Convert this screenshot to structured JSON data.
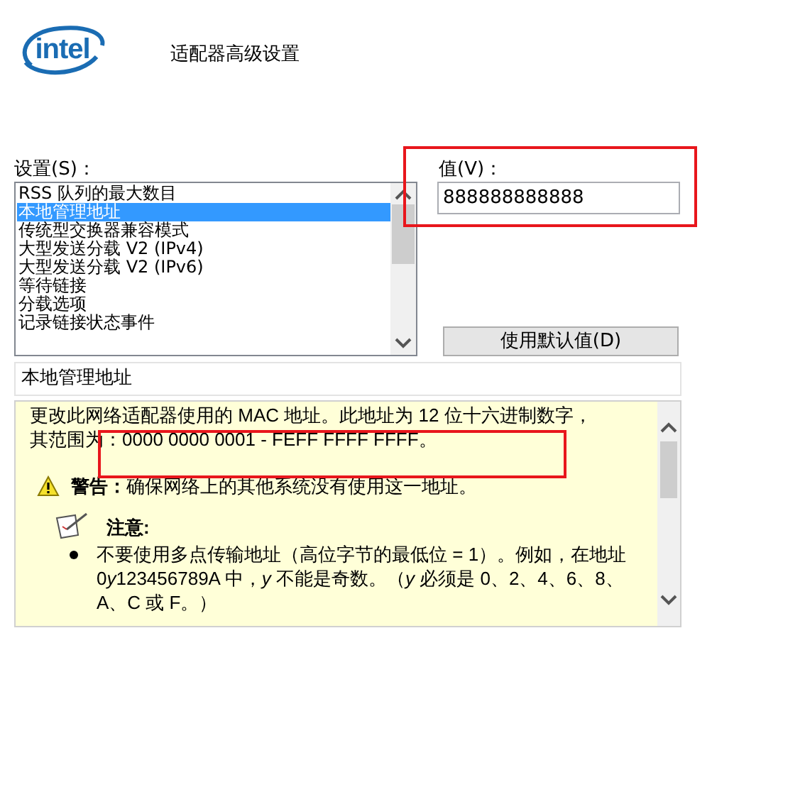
{
  "logo": {
    "text": "intel"
  },
  "title": "适配器高级设置",
  "settings": {
    "label": "设置(S)：",
    "items": [
      {
        "label": "RSS 队列的最大数目",
        "selected": false
      },
      {
        "label": "本地管理地址",
        "selected": true
      },
      {
        "label": "传统型交换器兼容模式",
        "selected": false
      },
      {
        "label": "大型发送分载 V2 (IPv4)",
        "selected": false
      },
      {
        "label": "大型发送分载 V2 (IPv6)",
        "selected": false
      },
      {
        "label": "等待链接",
        "selected": false
      },
      {
        "label": "分载选项",
        "selected": false
      },
      {
        "label": "记录链接状态事件",
        "selected": false
      }
    ]
  },
  "value": {
    "label": "值(V)：",
    "value": "888888888888"
  },
  "default_button": "使用默认值(D)",
  "description": "本地管理地址",
  "help": {
    "paragraph": "更改此网络适配器使用的 MAC 地址。此地址为 12 位十六进制数字，其范围为：0000 0000 0001 - FEFF FFFF FFFF。",
    "warning": "**警告：**确保网络上的其他系统没有使用这一地址。",
    "note_title": "注意:",
    "bullets": [
      [
        {
          "text": "不要使用多点传输地址（高位字节的最低位 = 1）。例如，在地址 0",
          "italic": false
        },
        {
          "text": "y",
          "italic": true
        },
        {
          "text": "123456789A 中，",
          "italic": false
        },
        {
          "text": "y",
          "italic": true
        },
        {
          "text": " 不能是奇数。（",
          "italic": false
        },
        {
          "text": "y",
          "italic": true
        },
        {
          "text": " 必须是 0、2、4、6、8、A、C 或 F。）",
          "italic": false
        }
      ]
    ]
  }
}
